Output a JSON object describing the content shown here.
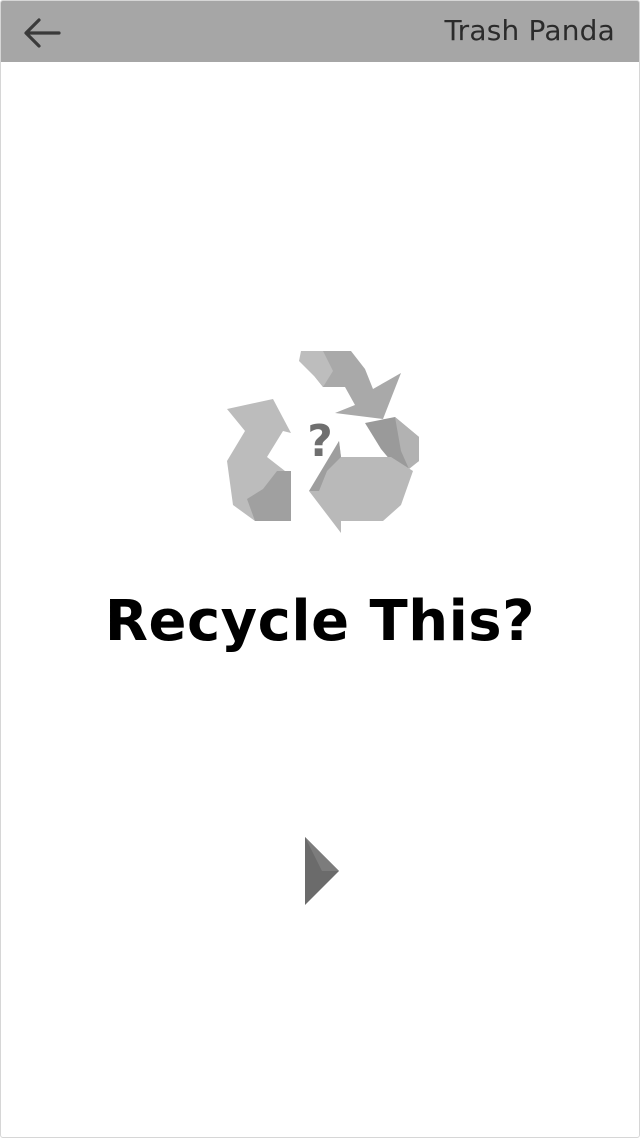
{
  "app_bar": {
    "title": "Trash Panda",
    "back_icon": "arrow-left-icon",
    "background": "#a6a6a6"
  },
  "main": {
    "icon": "recycle-question-icon",
    "icon_glyph": "?",
    "headline": "Recycle This?",
    "next_icon": "play-triangle-icon"
  }
}
